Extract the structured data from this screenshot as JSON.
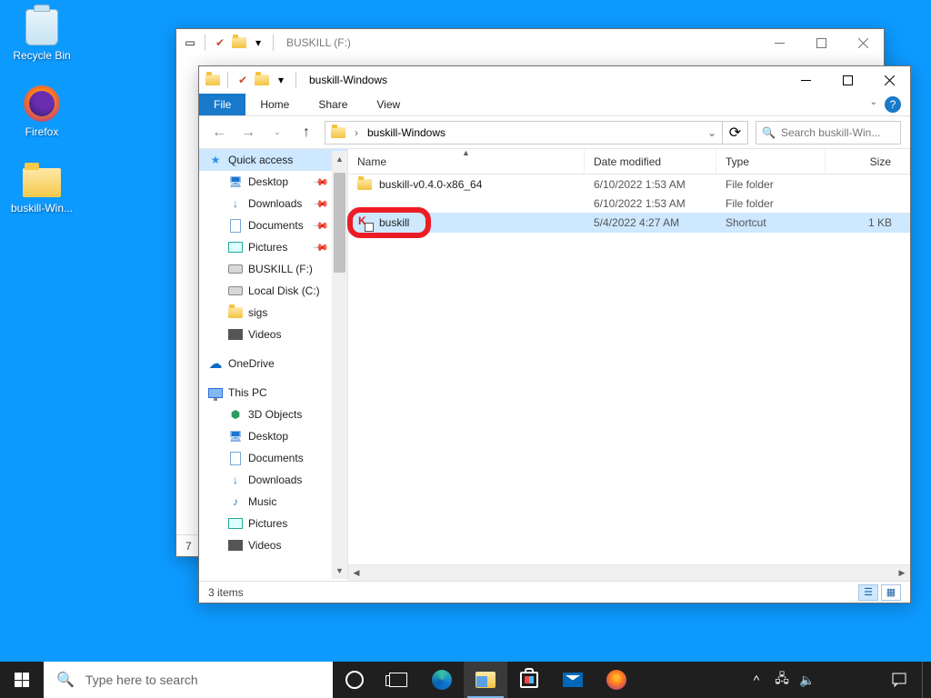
{
  "desktop": {
    "icons": [
      {
        "name": "recycle-bin",
        "label": "Recycle Bin"
      },
      {
        "name": "firefox",
        "label": "Firefox"
      },
      {
        "name": "buskill-folder",
        "label": "buskill-Win..."
      }
    ]
  },
  "bg_window": {
    "title": "BUSKILL (F:)",
    "status_left_fragment": "7"
  },
  "fg_window": {
    "title": "buskill-Windows",
    "ribbon": {
      "file": "File",
      "home": "Home",
      "share": "Share",
      "view": "View"
    },
    "breadcrumb": {
      "root_icon": "folder",
      "segment": "buskill-Windows"
    },
    "search_placeholder": "Search buskill-Win...",
    "columns": {
      "name": "Name",
      "date": "Date modified",
      "type": "Type",
      "size": "Size"
    },
    "rows": [
      {
        "icon": "folder",
        "name": "buskill-v0.4.0-x86_64",
        "date": "6/10/2022 1:53 AM",
        "type": "File folder",
        "size": ""
      },
      {
        "icon": "folder-hidden",
        "name": "",
        "date": "6/10/2022 1:53 AM",
        "type": "File folder",
        "size": ""
      },
      {
        "icon": "shortcut",
        "name": "buskill",
        "date": "5/4/2022 4:27 AM",
        "type": "Shortcut",
        "size": "1 KB",
        "selected": true
      }
    ],
    "status": "3 items",
    "navpane": {
      "quick_access": "Quick access",
      "qa_items": [
        {
          "label": "Desktop",
          "pinned": true,
          "ico": "desktop"
        },
        {
          "label": "Downloads",
          "pinned": true,
          "ico": "downloads"
        },
        {
          "label": "Documents",
          "pinned": true,
          "ico": "documents"
        },
        {
          "label": "Pictures",
          "pinned": true,
          "ico": "pictures"
        },
        {
          "label": "BUSKILL (F:)",
          "pinned": false,
          "ico": "drive"
        },
        {
          "label": "Local Disk (C:)",
          "pinned": false,
          "ico": "drive"
        },
        {
          "label": "sigs",
          "pinned": false,
          "ico": "folder"
        },
        {
          "label": "Videos",
          "pinned": false,
          "ico": "videos"
        }
      ],
      "onedrive": "OneDrive",
      "this_pc": "This PC",
      "pc_items": [
        {
          "label": "3D Objects",
          "ico": "3d"
        },
        {
          "label": "Desktop",
          "ico": "desktop"
        },
        {
          "label": "Documents",
          "ico": "documents"
        },
        {
          "label": "Downloads",
          "ico": "downloads"
        },
        {
          "label": "Music",
          "ico": "music"
        },
        {
          "label": "Pictures",
          "ico": "pictures"
        },
        {
          "label": "Videos",
          "ico": "videos"
        }
      ]
    }
  },
  "taskbar": {
    "search_placeholder": "Type here to search"
  }
}
